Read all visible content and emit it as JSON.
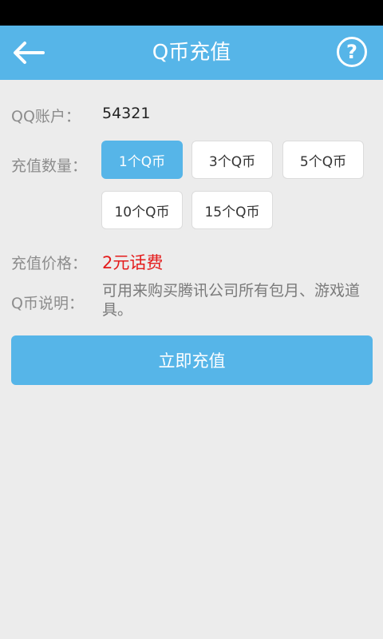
{
  "header": {
    "title": "Q币充值",
    "back_icon": "arrow-left-icon",
    "help_label": "?"
  },
  "account": {
    "label": "QQ账户：",
    "value": "54321"
  },
  "amount": {
    "label": "充值数量：",
    "options": [
      "1个Q币",
      "3个Q币",
      "5个Q币",
      "10个Q币",
      "15个Q币"
    ],
    "selected": "1个Q币"
  },
  "price": {
    "label": "充值价格：",
    "value": "2元话费"
  },
  "description": {
    "label": "Q币说明：",
    "text": "可用来购买腾讯公司所有包月、游戏道具。"
  },
  "submit_label": "立即充值",
  "colors": {
    "accent": "#56b5e8",
    "price": "#e41b1b"
  }
}
